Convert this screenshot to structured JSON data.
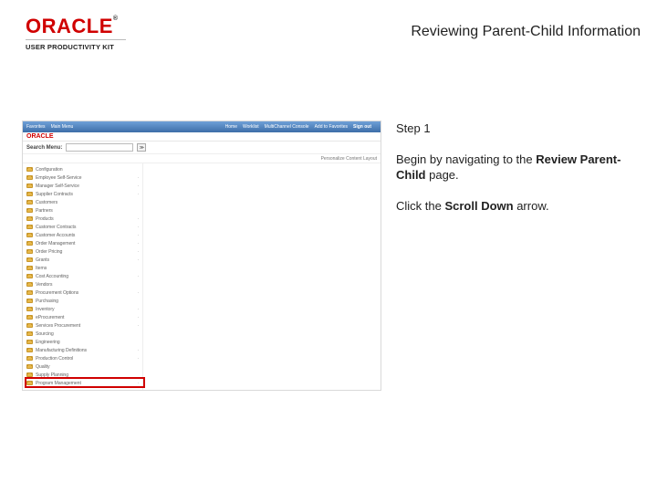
{
  "header": {
    "brand": "ORACLE",
    "tm": "®",
    "upk": "USER PRODUCTIVITY KIT",
    "title": "Reviewing Parent-Child Information"
  },
  "instructions": {
    "step": "Step 1",
    "line1a": "Begin by navigating to the ",
    "line1b": "Review Parent-Child",
    "line1c": " page.",
    "line2a": "Click the ",
    "line2b": "Scroll Down",
    "line2c": " arrow."
  },
  "screenshot": {
    "topbar": {
      "favorites": "Favorites",
      "mainmenu": "Main Menu",
      "home": "Home",
      "worklist": "Worklist",
      "multichannel": "MultiChannel Console",
      "addfav": "Add to Favorites",
      "signout": "Sign out"
    },
    "mini_brand": "ORACLE",
    "search": {
      "label": "Search Menu:",
      "go": "≫"
    },
    "subtoolbar": {
      "personalize": "Personalize Content   Layout"
    },
    "menu_items": [
      "Configuration",
      "Employee Self-Service",
      "Manager Self-Service",
      "Supplier Contracts",
      "Customers",
      "Partners",
      "Products",
      "Customer Contracts",
      "Customer Accounts",
      "Order Management",
      "Order Pricing",
      "Grants",
      "Items",
      "Cost Accounting",
      "Vendors",
      "Procurement Options",
      "Purchasing",
      "Inventory",
      "eProcurement",
      "Services Procurement",
      "Sourcing",
      "Engineering",
      "Manufacturing Definitions",
      "Production Control",
      "Quality",
      "Supply Planning",
      "Program Management"
    ],
    "dots": [
      false,
      true,
      true,
      true,
      false,
      false,
      true,
      true,
      true,
      true,
      true,
      true,
      false,
      true,
      false,
      true,
      false,
      true,
      true,
      true,
      false,
      false,
      true,
      true,
      false,
      false,
      true
    ]
  }
}
